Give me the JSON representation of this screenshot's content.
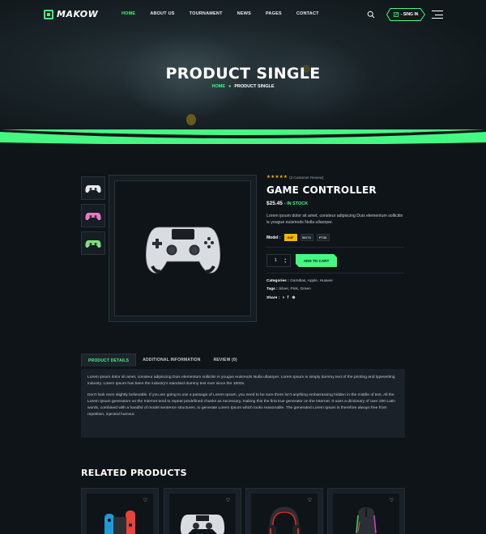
{
  "brand": {
    "name": "MAKOW"
  },
  "nav": {
    "items": [
      {
        "label": "HOME",
        "active": true
      },
      {
        "label": "ABOUT US",
        "active": false
      },
      {
        "label": "TOURNAMENT",
        "active": false
      },
      {
        "label": "NEWS",
        "active": false
      },
      {
        "label": "PAGES",
        "active": false
      },
      {
        "label": "CONTACT",
        "active": false
      }
    ],
    "signin_label": "SING IN"
  },
  "hero": {
    "title": "PRODUCT SINGLE",
    "breadcrumb_home": "HOME",
    "breadcrumb_current": "PRODUCT SINGLE"
  },
  "product": {
    "rating_stars": "★★★★★",
    "rating_text": "(3 Customer Review)",
    "title": "GAME CONTROLLER",
    "price": "$25.45",
    "stock": "- IN STOCK",
    "description": "Lorem ipsum dolor sit amet, consteur adipiscing Duis elementum sollicitin is yougue euismods Nulla ullaorper.",
    "model_label": "Model :",
    "models": [
      {
        "label": "G4F",
        "active": true
      },
      {
        "label": "BG74",
        "active": false
      },
      {
        "label": "PT38",
        "active": false
      }
    ],
    "quantity": "1",
    "add_to_cart": "ADD TO CART",
    "categories_label": "Categories :",
    "categories": "Gamdias, Apple, Huawei",
    "tags_label": "Tags :",
    "tags": "Silver, Pink, Green",
    "share_label": "Share :",
    "thumb_colors": [
      "#e9ecef",
      "#e87ac8",
      "#7ee07a"
    ]
  },
  "tabs": {
    "items": [
      {
        "label": "PRODUCT DETAILS",
        "active": true
      },
      {
        "label": "ADDITIONAL INFORMATION",
        "active": false
      },
      {
        "label": "REVIEW (0)",
        "active": false
      }
    ],
    "paragraph_1": "Lorem ipsum dolor sit amet, consteur adipiscing Duis elementum sollicitin is yougue euismods Nulla ullaorper. Lorem Ipsum is simply dummy text of the printing and typesetting industry. Lorem Ipsum has been the industry's standard dummy text ever since the 1500s.",
    "paragraph_2": "Don't look even slightly believable. If you are going to use a passage of Lorem Ipsum, you need to be sure there isn't anything embarrassing hidden in the middle of text. All the Lorem Ipsum generators on the Internet tend to repeat predefined chunks as necessary, making this the first true generator on the Internet. It uses a dictionary of over 200 Latin words, combined with a handful of model sentence structures, to generate Lorem Ipsum which looks reasonable. The generated Lorem Ipsum is therefore always free from repetition, injected humour."
  },
  "related": {
    "title": "RELATED PRODUCTS",
    "items": [
      {
        "icon": "switch-controller-icon"
      },
      {
        "icon": "gamepad-icon"
      },
      {
        "icon": "headset-icon"
      },
      {
        "icon": "gaming-mouse-icon"
      }
    ]
  },
  "colors": {
    "accent": "#45f882",
    "background": "#0f1419",
    "star": "#f7b500"
  }
}
